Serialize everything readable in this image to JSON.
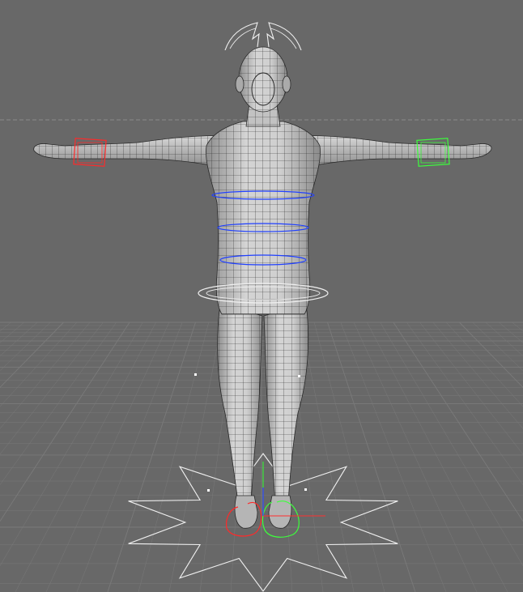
{
  "viewport": {
    "background": "#686868",
    "grid_color": "#7a7a7a",
    "horizon_color": "#8a8a8a"
  },
  "character": {
    "mesh_fill": "#c8c8c8",
    "mesh_shade": "#9a9a9a",
    "wire_color": "#2a2a2a"
  },
  "rig": {
    "left_wrist_control_color": "#ff2a2a",
    "right_wrist_control_color": "#3cff3c",
    "spine_ring_color": "#2040ff",
    "hip_ring_color": "#f0f0f0",
    "head_control_color": "#f0f0f0",
    "left_foot_control_color": "#ff2a2a",
    "right_foot_control_color": "#3cff3c",
    "root_star_color": "#f0f0f0",
    "axis_x_color": "#ff3030",
    "axis_y_color": "#30ff30",
    "axis_z_color": "#3050ff",
    "pole_marker_color": "#ffffff"
  }
}
